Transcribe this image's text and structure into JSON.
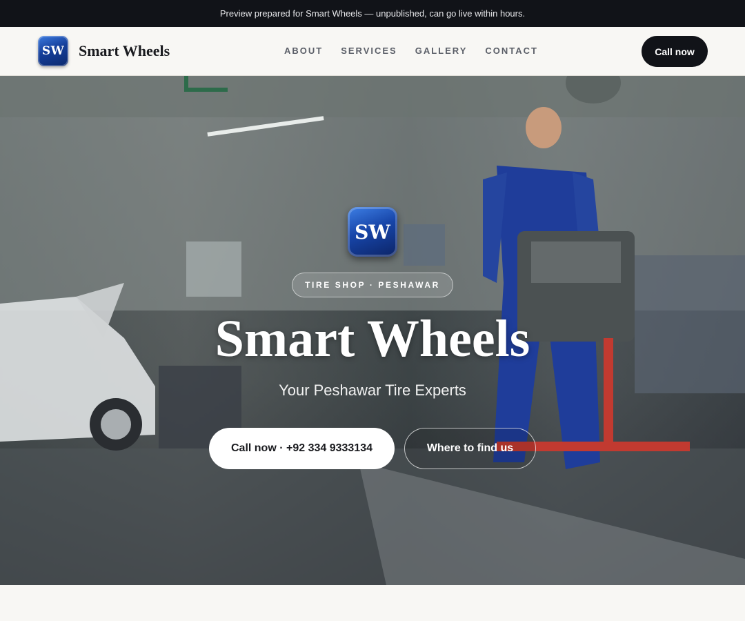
{
  "banner": {
    "text": "Preview prepared for Smart Wheels — unpublished, can go live within hours."
  },
  "header": {
    "logo_text": "SW",
    "brand": "Smart Wheels",
    "menu": [
      "ABOUT",
      "SERVICES",
      "GALLERY",
      "CONTACT"
    ],
    "call_label": "Call now"
  },
  "hero": {
    "logo_text": "SW",
    "tag": "TIRE SHOP · PESHAWAR",
    "title": "Smart Wheels",
    "subtitle": "Your Peshawar Tire Experts",
    "call_button": "Call now · +92 334 9333134",
    "find_button": "Where to find us"
  },
  "colors": {
    "dark": "#111318",
    "logo_blue": "#1745a8",
    "page_bg": "#f8f7f4"
  },
  "icons": {
    "hero_image": "garage-mechanic-photo"
  }
}
